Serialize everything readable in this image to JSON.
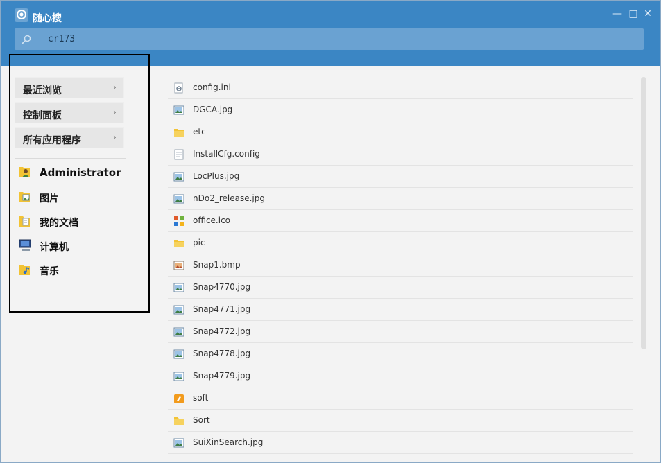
{
  "window": {
    "title": "随心搜",
    "minimize": "—",
    "maximize": "□",
    "close": "✕"
  },
  "search": {
    "query": "cr173"
  },
  "sidebar": {
    "menu": [
      {
        "label": "最近浏览",
        "arrow": "›"
      },
      {
        "label": "控制面板",
        "arrow": "›"
      },
      {
        "label": "所有应用程序",
        "arrow": "›"
      }
    ],
    "places": [
      {
        "label": "Administrator",
        "icon": "user-folder-icon"
      },
      {
        "label": "图片",
        "icon": "pictures-folder-icon"
      },
      {
        "label": "我的文档",
        "icon": "documents-folder-icon"
      },
      {
        "label": "计算机",
        "icon": "computer-icon"
      },
      {
        "label": "音乐",
        "icon": "music-folder-icon"
      }
    ]
  },
  "files": [
    {
      "name": "config.ini",
      "icon": "settings-file-icon"
    },
    {
      "name": "DGCA.jpg",
      "icon": "image-file-icon"
    },
    {
      "name": "etc",
      "icon": "folder-icon"
    },
    {
      "name": "InstallCfg.config",
      "icon": "text-file-icon"
    },
    {
      "name": "LocPlus.jpg",
      "icon": "image-file-icon"
    },
    {
      "name": "nDo2_release.jpg",
      "icon": "image-file-icon"
    },
    {
      "name": "office.ico",
      "icon": "office-icon-file-icon"
    },
    {
      "name": "pic",
      "icon": "folder-icon"
    },
    {
      "name": "Snap1.bmp",
      "icon": "bitmap-file-icon"
    },
    {
      "name": "Snap4770.jpg",
      "icon": "image-file-icon"
    },
    {
      "name": "Snap4771.jpg",
      "icon": "image-file-icon"
    },
    {
      "name": "Snap4772.jpg",
      "icon": "image-file-icon"
    },
    {
      "name": "Snap4778.jpg",
      "icon": "image-file-icon"
    },
    {
      "name": "Snap4779.jpg",
      "icon": "image-file-icon"
    },
    {
      "name": "soft",
      "icon": "special-folder-icon"
    },
    {
      "name": "Sort",
      "icon": "folder-icon"
    },
    {
      "name": "SuiXinSearch.jpg",
      "icon": "image-file-icon"
    }
  ],
  "colors": {
    "header": "#3b86c4",
    "search_bg": "#6aa2d2",
    "folder": "#f2c335"
  }
}
